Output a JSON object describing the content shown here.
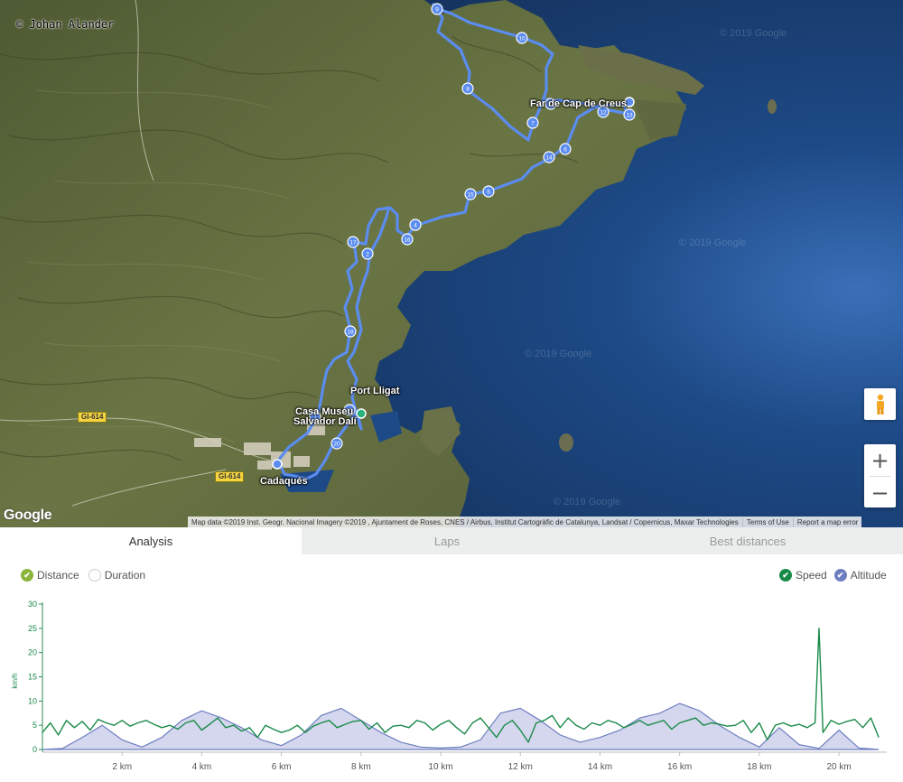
{
  "map": {
    "copyright": "© Johan Alander",
    "watermark": "© 2019 Google",
    "places": [
      {
        "name": "Far de Cap de Creus"
      },
      {
        "name": "Port Lligat"
      },
      {
        "name": "Casa Museu"
      },
      {
        "name": "Salvador Dalí"
      },
      {
        "name": "Cadaqués"
      }
    ],
    "roads": [
      "GI-614",
      "GI-614"
    ],
    "google_logo": "Google",
    "attribution": "Map data ©2019 Inst. Geogr. Nacional Imagery ©2019 , Ajuntament de Roses, CNES / Airbus, Institut Cartogràfic de Catalunya, Landsat / Copernicus, Maxar Technologies",
    "terms": "Terms of Use",
    "report": "Report a map error",
    "zoom_in": "+",
    "zoom_out": "−",
    "markers": [
      "1",
      "2",
      "3",
      "4",
      "5",
      "6",
      "7",
      "8",
      "9",
      "10",
      "11",
      "12",
      "13",
      "14",
      "15",
      "16",
      "17",
      "18",
      "19",
      "20"
    ],
    "colors": {
      "track": "#5b8cf0",
      "sea": "#173a68",
      "land": "#5c6a3c"
    }
  },
  "tabs": [
    {
      "label": "Analysis",
      "active": true
    },
    {
      "label": "Laps",
      "active": false
    },
    {
      "label": "Best distances",
      "active": false
    }
  ],
  "toggles": {
    "left": [
      {
        "label": "Distance",
        "checked": true,
        "color": "#8ab43a"
      },
      {
        "label": "Duration",
        "checked": false,
        "color": "#cccccc"
      }
    ],
    "right": [
      {
        "label": "Speed",
        "checked": true,
        "color": "#1a8a4a"
      },
      {
        "label": "Altitude",
        "checked": true,
        "color": "#6e7fc0"
      }
    ]
  },
  "chart_data": {
    "type": "line",
    "xlabel": "",
    "ylabel": "km/h",
    "ylim": [
      0,
      30
    ],
    "xlim": [
      0,
      21.2
    ],
    "y_ticks": [
      0,
      5,
      10,
      15,
      20,
      25,
      30
    ],
    "x_ticks": [
      {
        "value": 2,
        "label": "2 km"
      },
      {
        "value": 4,
        "label": "4 km"
      },
      {
        "value": 6,
        "label": "6 km"
      },
      {
        "value": 8,
        "label": "8 km"
      },
      {
        "value": 10,
        "label": "10 km"
      },
      {
        "value": 12,
        "label": "12 km"
      },
      {
        "value": 14,
        "label": "14 km"
      },
      {
        "value": 16,
        "label": "16 km"
      },
      {
        "value": 18,
        "label": "18 km"
      },
      {
        "value": 20,
        "label": "20 km"
      }
    ],
    "colors": {
      "speed": "#1a8a4a",
      "altitude_fill": "#c9cde8",
      "altitude_stroke": "#6e7fc0"
    },
    "series": [
      {
        "name": "Speed",
        "x": [
          0.0,
          0.2,
          0.4,
          0.6,
          0.8,
          1.0,
          1.2,
          1.4,
          1.6,
          1.8,
          2.0,
          2.2,
          2.4,
          2.6,
          2.8,
          3.0,
          3.2,
          3.4,
          3.6,
          3.8,
          4.0,
          4.2,
          4.4,
          4.6,
          4.8,
          5.0,
          5.2,
          5.4,
          5.6,
          5.8,
          6.0,
          6.2,
          6.4,
          6.6,
          6.8,
          7.0,
          7.2,
          7.4,
          7.6,
          7.8,
          8.0,
          8.2,
          8.4,
          8.6,
          8.8,
          9.0,
          9.2,
          9.4,
          9.6,
          9.8,
          10.0,
          10.2,
          10.4,
          10.6,
          10.8,
          11.0,
          11.2,
          11.4,
          11.6,
          11.8,
          12.0,
          12.2,
          12.4,
          12.6,
          12.8,
          13.0,
          13.2,
          13.4,
          13.6,
          13.8,
          14.0,
          14.2,
          14.4,
          14.6,
          14.8,
          15.0,
          15.2,
          15.4,
          15.6,
          15.8,
          16.0,
          16.2,
          16.4,
          16.6,
          16.8,
          17.0,
          17.2,
          17.4,
          17.6,
          17.8,
          18.0,
          18.2,
          18.4,
          18.6,
          18.8,
          19.0,
          19.2,
          19.4,
          19.5,
          19.6,
          19.8,
          20.0,
          20.2,
          20.4,
          20.6,
          20.8,
          21.0
        ],
        "values": [
          3.5,
          5.5,
          3.0,
          6.0,
          4.5,
          5.8,
          4.0,
          6.2,
          5.5,
          5.0,
          6.0,
          4.8,
          5.5,
          6.0,
          5.2,
          4.5,
          5.0,
          4.2,
          5.5,
          6.0,
          4.0,
          5.2,
          6.5,
          4.5,
          5.0,
          3.8,
          4.5,
          2.5,
          5.0,
          4.2,
          3.5,
          4.0,
          5.0,
          3.5,
          4.8,
          5.5,
          6.0,
          4.5,
          5.2,
          5.8,
          6.0,
          4.2,
          5.5,
          3.5,
          4.8,
          5.0,
          4.5,
          6.0,
          5.5,
          4.0,
          5.2,
          6.0,
          4.5,
          3.2,
          5.5,
          6.5,
          4.5,
          2.5,
          5.0,
          6.0,
          4.0,
          1.5,
          5.5,
          6.0,
          7.0,
          4.5,
          6.5,
          5.0,
          4.2,
          5.5,
          5.0,
          6.0,
          5.5,
          4.5,
          5.2,
          6.0,
          5.0,
          5.5,
          6.0,
          4.2,
          5.5,
          6.0,
          6.5,
          5.0,
          5.5,
          5.2,
          4.8,
          5.0,
          6.0,
          3.5,
          5.5,
          2.0,
          5.0,
          5.5,
          4.8,
          5.2,
          4.5,
          5.5,
          25.0,
          3.5,
          6.0,
          5.2,
          5.8,
          6.2,
          4.5,
          6.5,
          2.5
        ]
      },
      {
        "name": "Altitude",
        "x": [
          0.0,
          0.5,
          1.0,
          1.5,
          2.0,
          2.5,
          3.0,
          3.5,
          4.0,
          4.5,
          5.0,
          5.5,
          6.0,
          6.5,
          7.0,
          7.5,
          8.0,
          8.5,
          9.0,
          9.5,
          10.0,
          10.5,
          11.0,
          11.5,
          12.0,
          12.5,
          13.0,
          13.5,
          14.0,
          14.5,
          15.0,
          15.5,
          16.0,
          16.5,
          17.0,
          17.5,
          18.0,
          18.5,
          19.0,
          19.5,
          20.0,
          20.5,
          21.0
        ],
        "values": [
          0.0,
          0.2,
          2.5,
          5.0,
          2.0,
          0.5,
          2.5,
          6.0,
          8.0,
          6.5,
          4.5,
          2.0,
          0.8,
          3.0,
          7.0,
          8.5,
          6.0,
          3.5,
          1.5,
          0.5,
          0.3,
          0.5,
          2.0,
          7.5,
          8.5,
          6.0,
          3.0,
          1.5,
          2.5,
          4.0,
          6.5,
          7.5,
          9.5,
          8.0,
          5.0,
          2.5,
          0.5,
          4.5,
          1.0,
          0.2,
          4.0,
          0.3,
          0.0
        ]
      }
    ]
  }
}
